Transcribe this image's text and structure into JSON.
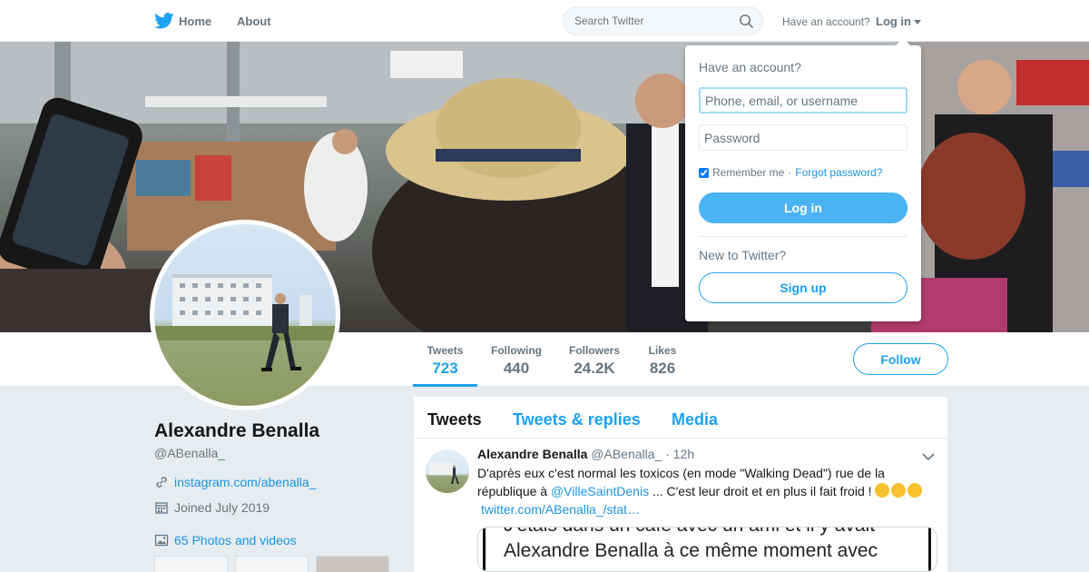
{
  "nav": {
    "home_label": "Home",
    "about_label": "About",
    "search_placeholder": "Search Twitter",
    "have_account_text": "Have an account?",
    "login_label": "Log in"
  },
  "profile": {
    "name": "Alexandre Benalla",
    "handle": "@ABenalla_",
    "website": "instagram.com/abenalla_",
    "joined": "Joined July 2019",
    "photos_label": "65 Photos and videos"
  },
  "stats": [
    {
      "label": "Tweets",
      "value": "723"
    },
    {
      "label": "Following",
      "value": "440"
    },
    {
      "label": "Followers",
      "value": "24.2K"
    },
    {
      "label": "Likes",
      "value": "826"
    }
  ],
  "follow_label": "Follow",
  "timeline": {
    "tabs": [
      "Tweets",
      "Tweets & replies",
      "Media"
    ],
    "tweet": {
      "name": "Alexandre Benalla",
      "handle": "@ABenalla_",
      "time": "· 12h",
      "text_1": "D'après eux c'est normal les toxicos (en mode \"Walking Dead\") rue de la république à",
      "mention": "@VilleSaintDenis",
      "text_2": "... C'est leur droit et en plus il fait froid !",
      "url": "twitter.com/ABenalla_/stat…",
      "media_line_1": "J'étais dans un café avec un ami et il y avait",
      "media_line_2": "Alexandre Benalla à ce même moment avec"
    }
  },
  "login_dropdown": {
    "title": "Have an account?",
    "username_placeholder": "Phone, email, or username",
    "password_placeholder": "Password",
    "remember_label": "Remember me",
    "separator": "·",
    "forgot_label": "Forgot password?",
    "login_button": "Log in",
    "new_text": "New to Twitter?",
    "signup_button": "Sign up"
  },
  "colors": {
    "brand_blue": "#1da1f2",
    "link_blue": "#1b95e0",
    "background": "#e6ecf0"
  }
}
